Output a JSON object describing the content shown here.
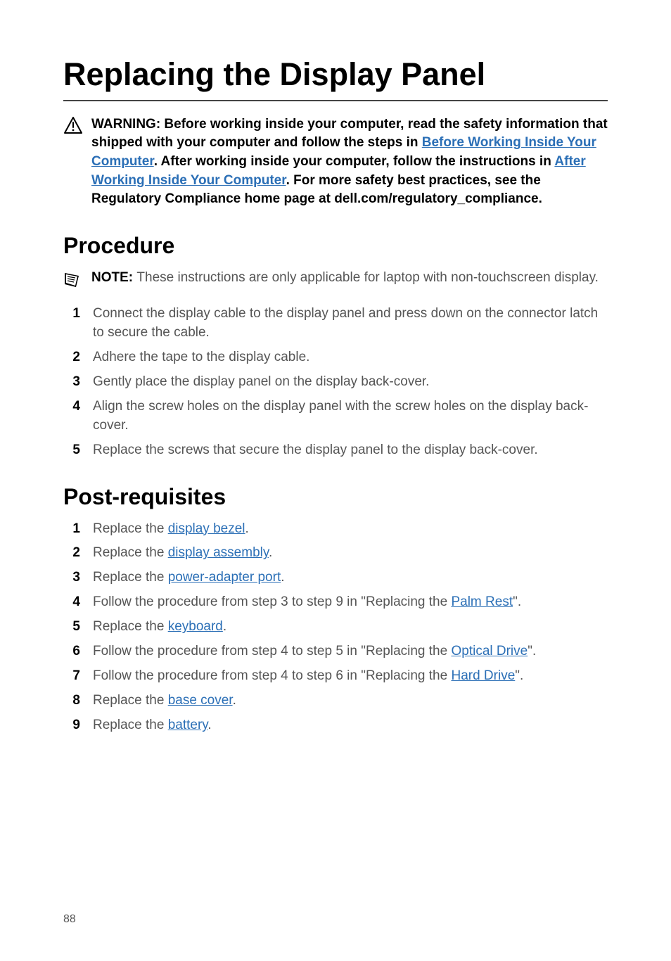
{
  "title": "Replacing the Display Panel",
  "warning": {
    "lead": "WARNING: Before working inside your computer, read the safety information that shipped with your computer and follow the steps in ",
    "link1": "Before Working Inside Your Computer",
    "mid1": ". After working inside your computer, follow the instructions in ",
    "link2": "After Working Inside Your Computer",
    "tail": ". For more safety best practices, see the Regulatory Compliance home page at dell.com/regulatory_compliance."
  },
  "procedure": {
    "heading": "Procedure",
    "note_label": "NOTE: ",
    "note_text": "These instructions are only applicable for laptop with non-touchscreen display.",
    "steps": [
      "Connect the display cable to the display panel and press down on the connector latch to secure the cable.",
      "Adhere the tape to the display cable.",
      "Gently place the display panel on the display back-cover.",
      "Align the screw holes on the display panel with the screw holes on the display back-cover.",
      "Replace the screws that secure the display panel to the display back-cover."
    ]
  },
  "postreq": {
    "heading": "Post-requisites",
    "s1_a": "Replace the ",
    "s1_link": "display bezel",
    "s1_b": ".",
    "s2_a": "Replace the ",
    "s2_link": "display assembly",
    "s2_b": ".",
    "s3_a": "Replace the ",
    "s3_link": "power-adapter port",
    "s3_b": ".",
    "s4_a": "Follow the procedure from step 3 to step 9 in \"Replacing the ",
    "s4_link": "Palm Rest",
    "s4_b": "\".",
    "s5_a": "Replace the ",
    "s5_link": "keyboard",
    "s5_b": ".",
    "s6_a": "Follow the procedure from step 4 to step 5 in \"Replacing the ",
    "s6_link": "Optical Drive",
    "s6_b": "\".",
    "s7_a": "Follow the procedure from step 4 to step 6 in \"Replacing the ",
    "s7_link": "Hard Drive",
    "s7_b": "\".",
    "s8_a": "Replace the ",
    "s8_link": "base cover",
    "s8_b": ".",
    "s9_a": "Replace the ",
    "s9_link": "battery",
    "s9_b": "."
  },
  "page_number": "88"
}
